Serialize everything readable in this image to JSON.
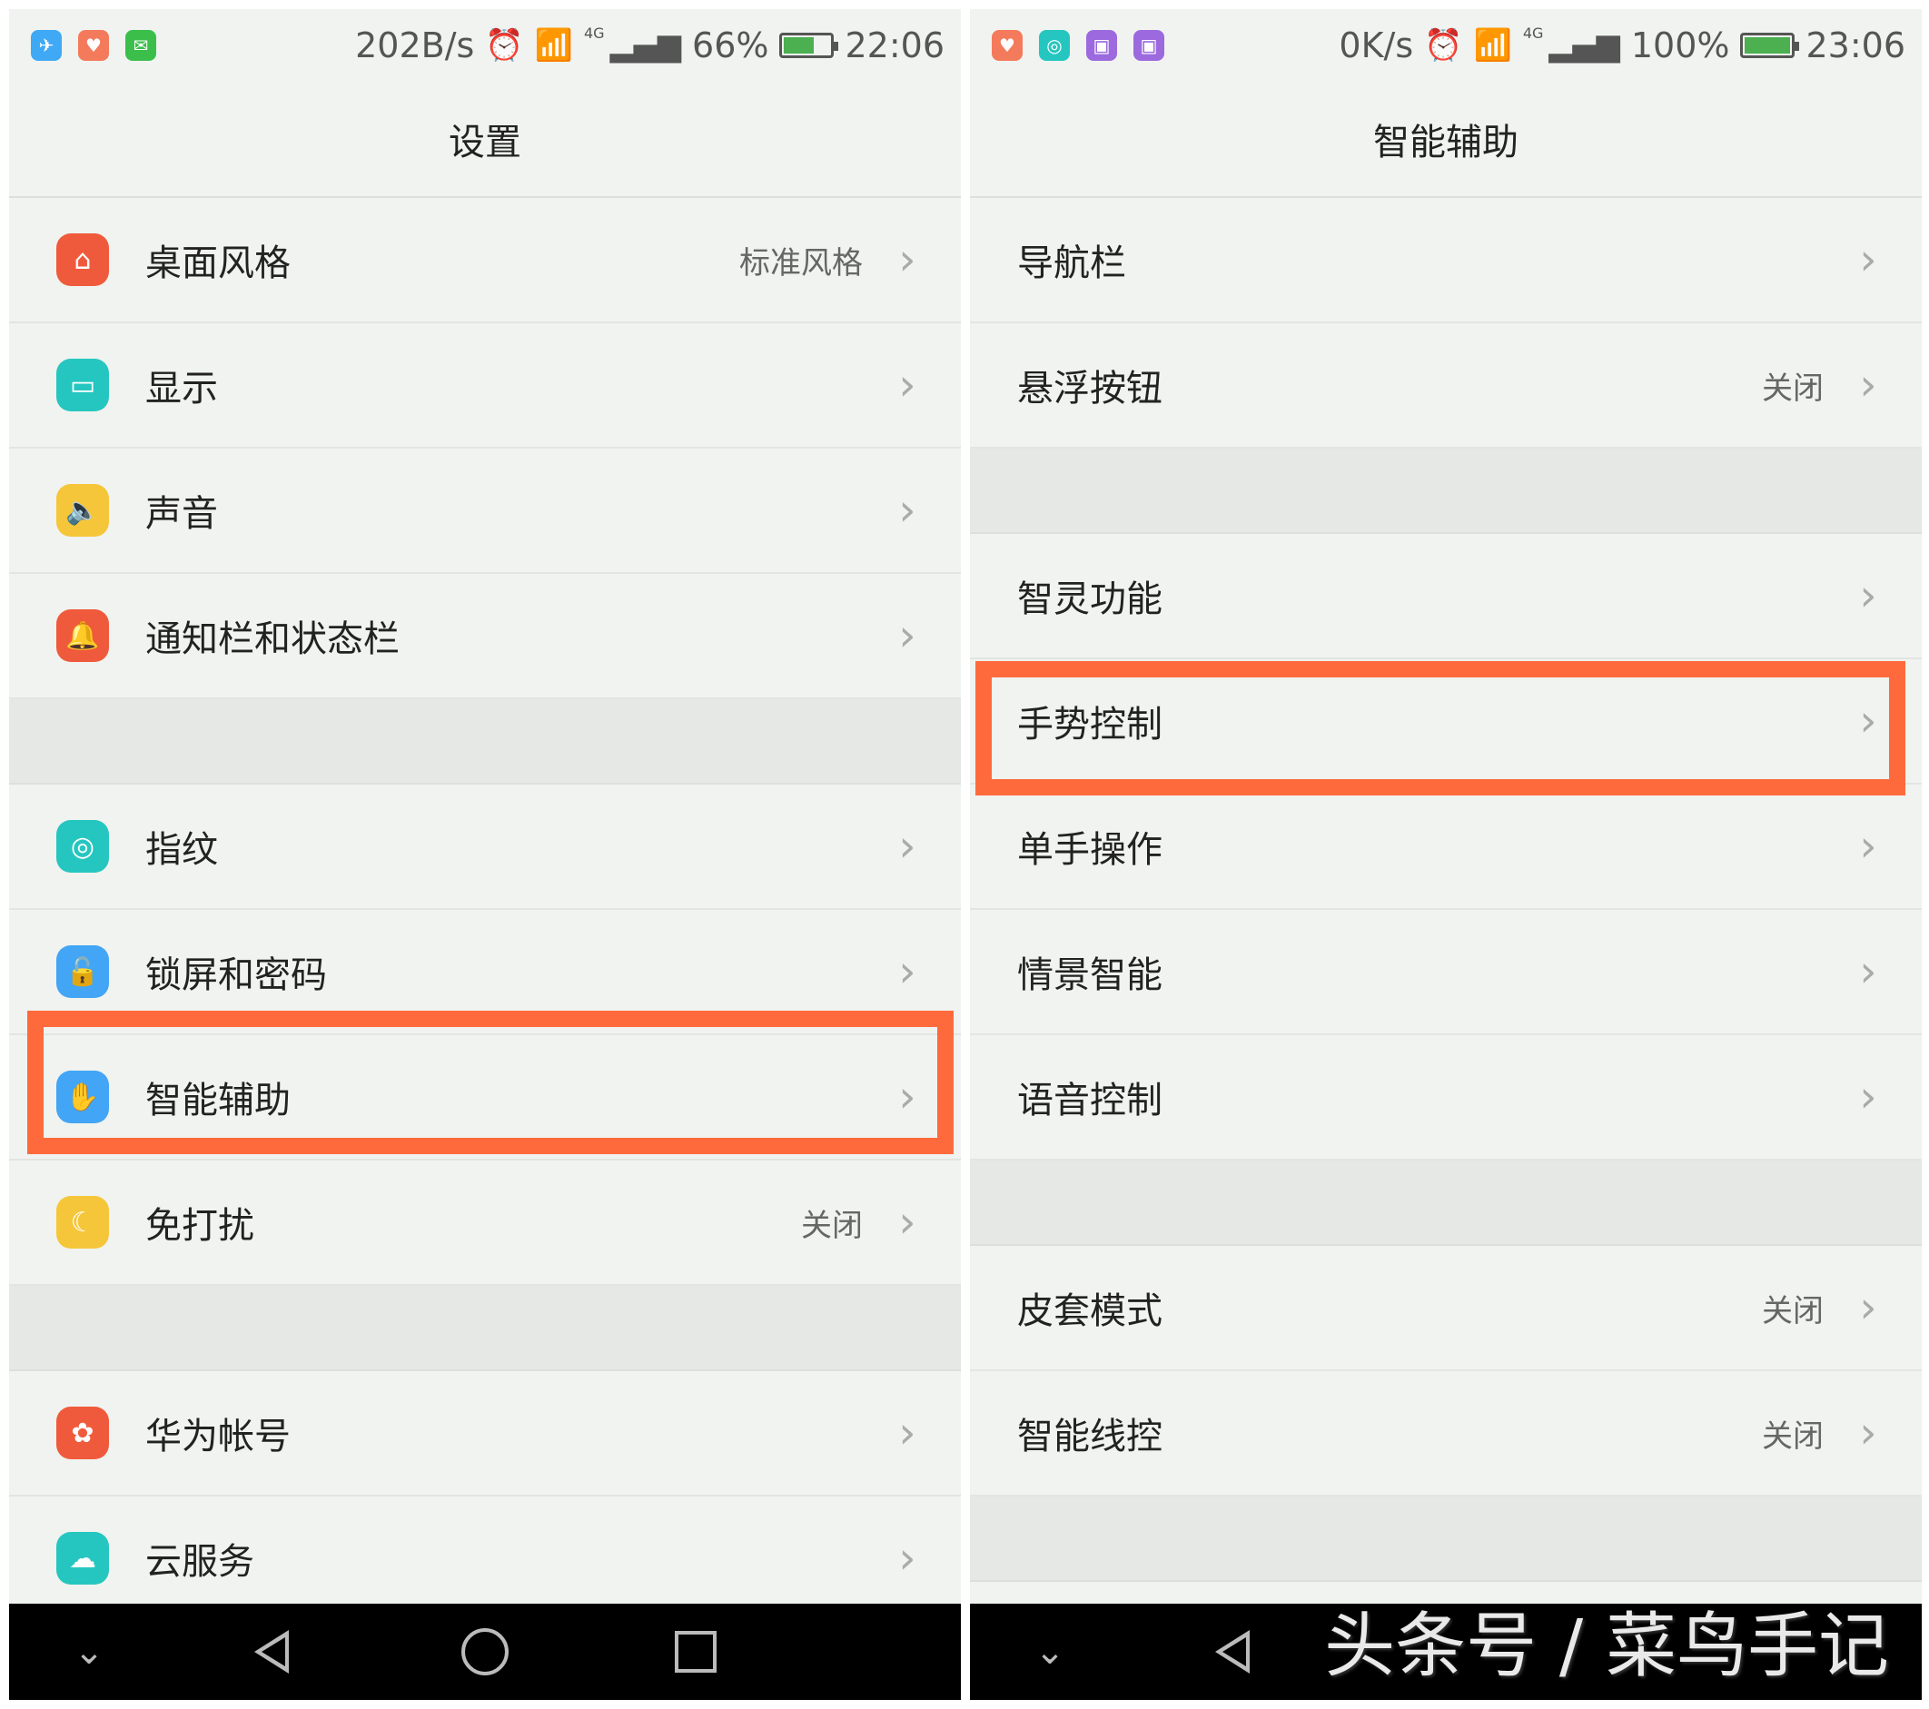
{
  "colors": {
    "accent_highlight": "#ff6a3d",
    "background": "#f0f3ef",
    "divider_section": "#e6e8e5"
  },
  "left": {
    "status": {
      "speed": "202B/s",
      "battery": "66%",
      "battery_level": 0.66,
      "time": "22:06",
      "network": "4G"
    },
    "title": "设置",
    "rows": [
      {
        "label": "桌面风格",
        "value": "标准风格",
        "icon": "home-icon",
        "color": "#f05a3c"
      },
      {
        "label": "显示",
        "value": "",
        "icon": "display-icon",
        "color": "#26c6c0"
      },
      {
        "label": "声音",
        "value": "",
        "icon": "speaker-icon",
        "color": "#f6c63a"
      },
      {
        "label": "通知栏和状态栏",
        "value": "",
        "icon": "bell-icon",
        "color": "#f05a3c"
      },
      {
        "label": "指纹",
        "value": "",
        "icon": "fingerprint-icon",
        "color": "#26c6c0"
      },
      {
        "label": "锁屏和密码",
        "value": "",
        "icon": "lock-icon",
        "color": "#42a5f5"
      },
      {
        "label": "智能辅助",
        "value": "",
        "icon": "hand-icon",
        "color": "#42a5f5"
      },
      {
        "label": "免打扰",
        "value": "关闭",
        "icon": "moon-icon",
        "color": "#f6c63a"
      },
      {
        "label": "华为帐号",
        "value": "",
        "icon": "huawei-icon",
        "color": "#f05a3c"
      },
      {
        "label": "云服务",
        "value": "",
        "icon": "cloud-icon",
        "color": "#26c6c0"
      }
    ]
  },
  "right": {
    "status": {
      "speed": "0K/s",
      "battery": "100%",
      "battery_level": 1.0,
      "time": "23:06",
      "network": "4G"
    },
    "title": "智能辅助",
    "rows": [
      {
        "label": "导航栏",
        "value": ""
      },
      {
        "label": "悬浮按钮",
        "value": "关闭"
      },
      {
        "label": "智灵功能",
        "value": ""
      },
      {
        "label": "手势控制",
        "value": ""
      },
      {
        "label": "单手操作",
        "value": ""
      },
      {
        "label": "情景智能",
        "value": ""
      },
      {
        "label": "语音控制",
        "value": ""
      },
      {
        "label": "皮套模式",
        "value": "关闭"
      },
      {
        "label": "智能线控",
        "value": "关闭"
      }
    ]
  },
  "watermark": "头条号 / 菜鸟手记"
}
